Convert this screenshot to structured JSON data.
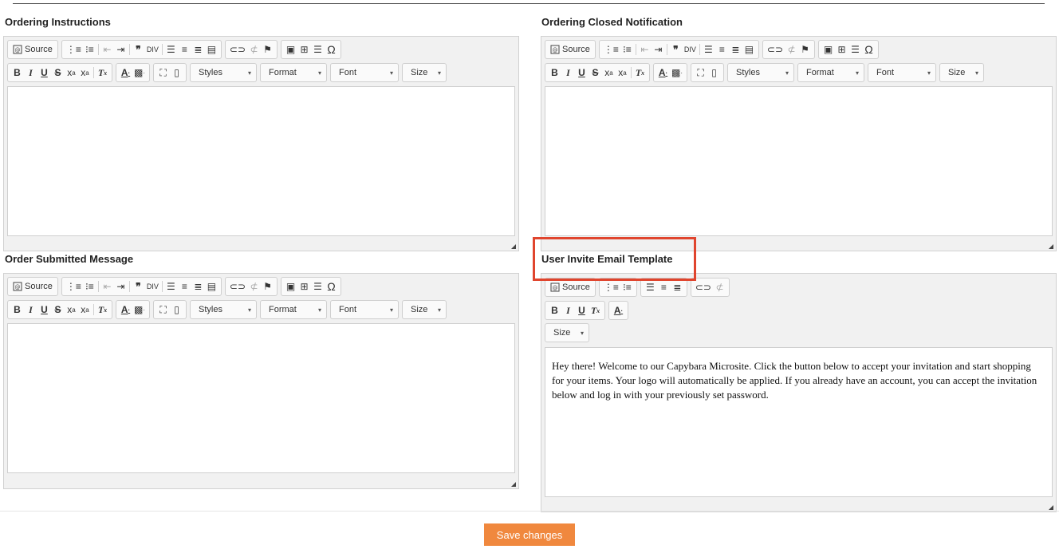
{
  "labels": {
    "ordering_instructions": "Ordering Instructions",
    "ordering_closed": "Ordering Closed Notification",
    "order_submitted": "Order Submitted Message",
    "user_invite": "User Invite Email Template"
  },
  "toolbar": {
    "source": "Source",
    "styles": "Styles",
    "format": "Format",
    "font": "Font",
    "size": "Size"
  },
  "icons": {
    "source": "source-icon",
    "numbered_list": "numbered-list-icon",
    "bulleted_list": "bulleted-list-icon",
    "outdent": "outdent-icon",
    "indent": "indent-icon",
    "blockquote": "blockquote-icon",
    "div": "div-icon",
    "align_left": "align-left-icon",
    "align_center": "align-center-icon",
    "align_right": "align-right-icon",
    "justify": "justify-icon",
    "link": "link-icon",
    "unlink": "unlink-icon",
    "anchor": "anchor-flag-icon",
    "image": "image-icon",
    "table": "table-icon",
    "horizontal_line": "horizontal-line-icon",
    "special_char": "omega-icon",
    "maximize": "maximize-icon",
    "show_blocks": "show-blocks-icon"
  },
  "invite_template_body": "Hey there! Welcome to our Capybara Microsite. Click the button below to accept your invitation and start shopping for your items. Your logo will automatically be applied.  If you already have an account, you can accept the invitation below and log in with your previously set password.",
  "save_label": "Save changes",
  "colors": {
    "accent": "#f0883e",
    "highlight": "#e0452e"
  }
}
